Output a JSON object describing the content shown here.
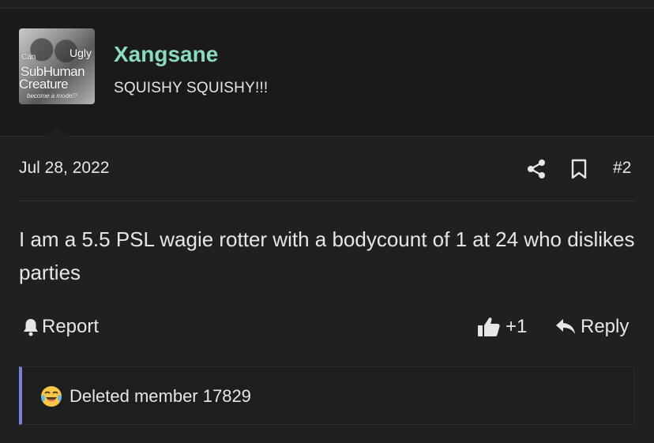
{
  "post": {
    "username": "Xangsane",
    "user_title": "SQUISHY SQUISHY!!!",
    "avatar_text": {
      "line1": "Can",
      "line2": "Ugly",
      "line3": "SubHuman",
      "line4": "Creature",
      "line5": "become a model?"
    },
    "date": "Jul 28, 2022",
    "post_number": "#2",
    "content": "I am a 5.5 PSL wagie rotter with a bodycount of 1 at 24 who dislikes parties",
    "report_label": "Report",
    "like_count": "+1",
    "reply_label": "Reply",
    "reaction_user": "Deleted member 17829"
  },
  "colors": {
    "username": "#8ad9c3",
    "reaction_bar": "#7b7fd6",
    "background": "#202021"
  },
  "icons": {
    "share": "share-icon",
    "bookmark": "bookmark-icon",
    "report": "bell-icon",
    "like": "thumbs-up-icon",
    "reply": "reply-arrow-icon",
    "reaction": "crying-laughing-emoji-icon"
  }
}
